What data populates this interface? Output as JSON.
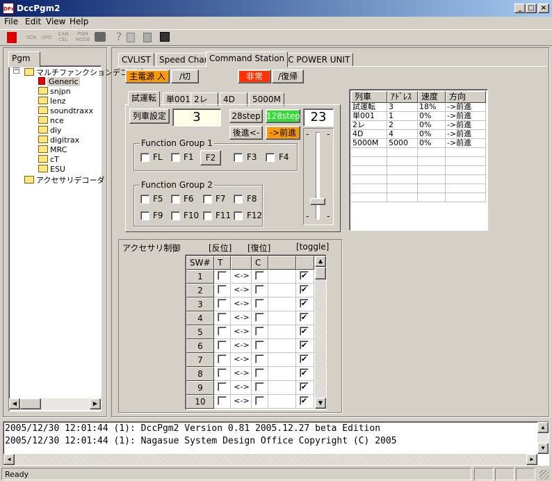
{
  "window": {
    "title": "DccPgm2",
    "app_icon": "DPx"
  },
  "menu": [
    "File",
    "Edit",
    "View",
    "Help"
  ],
  "toolbar": {
    "buttons": [
      {
        "name": "stop-icon",
        "label": ""
      },
      {
        "name": "scn-icon",
        "label": "SCN"
      },
      {
        "name": "upd-icon",
        "label": "UPD"
      },
      {
        "name": "cancel-icon",
        "label": "CAN\nCEL"
      },
      {
        "name": "pgm-mode-icon",
        "label": "PGM\nMODE"
      },
      {
        "name": "printer-icon",
        "label": ""
      },
      {
        "name": "help-icon",
        "label": "?"
      },
      {
        "name": "copy-icon",
        "label": ""
      },
      {
        "name": "paste-icon",
        "label": ""
      },
      {
        "name": "save-icon",
        "label": ""
      }
    ]
  },
  "left_panel": {
    "tab": "Pgm",
    "tree": {
      "root": "マルチファンクションデコーダ",
      "children": [
        "Generic",
        "snjpn",
        "lenz",
        "soundtraxx",
        "nce",
        "diy",
        "digitrax",
        "MRC",
        "cT",
        "ESU"
      ],
      "sibling": "アクセサリデコーダ"
    }
  },
  "main_tabs": [
    "CVLIST",
    "Speed Chart",
    "Command Station",
    "DC POWER UNIT"
  ],
  "power": {
    "on": "主電源 入",
    "off": "/切",
    "emergency": "非常",
    "recover": "/復帰"
  },
  "train_tabs": [
    "試運転",
    "単001",
    "2レ",
    "4D",
    "5000M"
  ],
  "train": {
    "settings_button": "列車設定",
    "address": "3",
    "step28": "28step",
    "step128": "128step",
    "speed": "23",
    "reverse": "後進<-",
    "forward": "->前進"
  },
  "fg1": {
    "title": "Function Group 1",
    "items": [
      "FL",
      "F1",
      "F2",
      "F3",
      "F4"
    ]
  },
  "fg2": {
    "title": "Function Group 2",
    "row1": [
      "F5",
      "F6",
      "F7",
      "F8"
    ],
    "row2": [
      "F9",
      "F10",
      "F11",
      "F12"
    ]
  },
  "slider": {
    "top_label": "-",
    "bottom_label": "-",
    "level_percent": 18
  },
  "train_list": {
    "headers": [
      "列車",
      "ｱﾄﾞﾚｽ",
      "速度",
      "方向"
    ],
    "rows": [
      [
        "試運転",
        "3",
        "18%",
        "->前進"
      ],
      [
        "単001",
        "1",
        "0%",
        "->前進"
      ],
      [
        "2レ",
        "2",
        "0%",
        "->前進"
      ],
      [
        "4D",
        "4",
        "0%",
        "->前進"
      ],
      [
        "5000M",
        "5000",
        "0%",
        "->前進"
      ]
    ]
  },
  "accessory": {
    "label": "アクセサリ制御",
    "col_reverse": "[反位]",
    "col_normal": "[復位]",
    "col_toggle": "[toggle]",
    "headers": [
      "SW#",
      "T",
      "",
      "C",
      "",
      ""
    ],
    "arrow": "<->",
    "rows": [
      "1",
      "2",
      "3",
      "4",
      "5",
      "6",
      "7",
      "8",
      "9",
      "10"
    ]
  },
  "log": [
    "2005/12/30 12:01:44 (1): DccPgm2 Version 0.81 2005.12.27 beta Edition",
    "2005/12/30 12:01:44 (1): Nagasue System Design Office Copyright (C) 2005"
  ],
  "status": "Ready",
  "colors": {
    "accent_orange": "#ff9900",
    "emergency_red": "#ff3300",
    "active_green": "#33dd33",
    "title_blue": "#0a246a"
  }
}
